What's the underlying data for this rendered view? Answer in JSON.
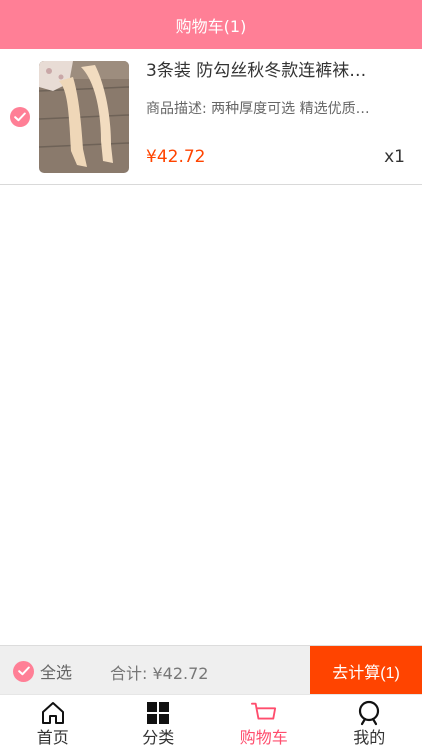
{
  "header": {
    "title": "购物车(1)"
  },
  "cart": {
    "items": [
      {
        "title": "3条装 防勾丝秋冬款连裤袜…",
        "desc": "商品描述: 两种厚度可选 精选优质…",
        "price": "¥42.72",
        "qty": "x1",
        "checked": true
      }
    ]
  },
  "checkout": {
    "select_all_label": "全选",
    "total_text": "合计: ¥42.72",
    "button_label": "去计算(1)"
  },
  "tabbar": {
    "tabs": [
      {
        "label": "首页",
        "icon": "home-icon"
      },
      {
        "label": "分类",
        "icon": "category-grid-icon"
      },
      {
        "label": "购物车",
        "icon": "cart-icon",
        "active": true
      },
      {
        "label": "我的",
        "icon": "profile-icon"
      }
    ]
  },
  "colors": {
    "accent": "#ff7f96",
    "price": "#ff4400",
    "checkout_button": "#ff4400"
  }
}
